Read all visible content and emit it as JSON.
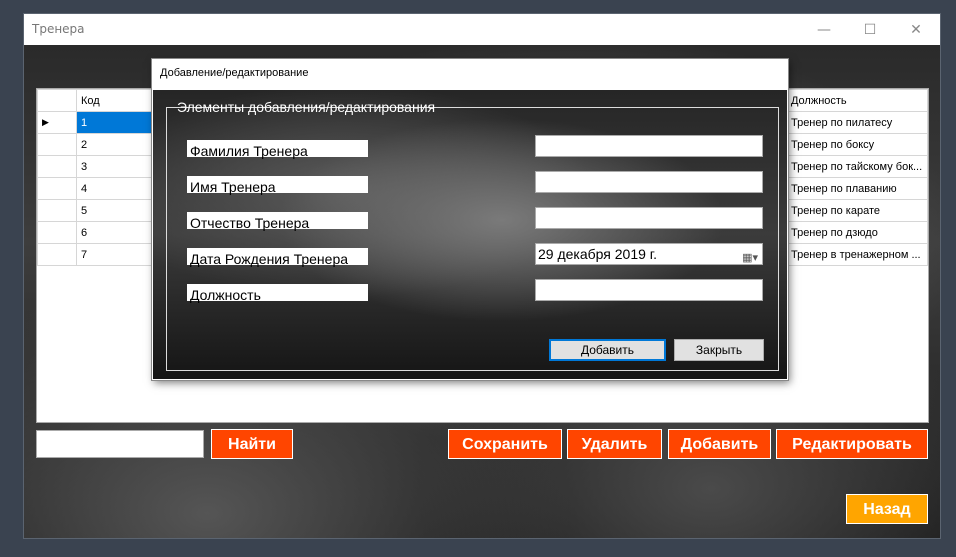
{
  "window": {
    "title": "Тренера",
    "minimize": "—",
    "maximize": "☐",
    "close": "✕"
  },
  "grid": {
    "headers": [
      "Код",
      "Должность"
    ],
    "rows": [
      {
        "code": "1",
        "position": "Тренер по пилатесу"
      },
      {
        "code": "2",
        "position": "Тренер по боксу"
      },
      {
        "code": "3",
        "position": "Тренер по тайскому бок..."
      },
      {
        "code": "4",
        "position": "Тренер по плаванию"
      },
      {
        "code": "5",
        "position": "Тренер по карате"
      },
      {
        "code": "6",
        "position": "Тренер по дзюдо"
      },
      {
        "code": "7",
        "position": "Тренер в тренажерном ..."
      }
    ]
  },
  "dialog": {
    "title": "Добавление/редактирование",
    "group_title": "Элементы добавления/редактирования",
    "labels": {
      "surname": "Фамилия Тренера",
      "name": "Имя Тренера",
      "patronymic": "Отчество Тренера",
      "birthdate": "Дата Рождения Тренера",
      "position": "Должность"
    },
    "values": {
      "surname": "",
      "name": "",
      "patronymic": "",
      "position": ""
    },
    "birthdate_value": "29  декабря  2019 г.",
    "add_button": "Добавить",
    "close_button": "Закрыть"
  },
  "toolbar": {
    "search_value": "",
    "find": "Найти",
    "save": "Сохранить",
    "delete": "Удалить",
    "add": "Добавить",
    "edit": "Редактировать",
    "back": "Назад"
  },
  "colors": {
    "action": "#ff4500",
    "back": "#ffa500",
    "selection": "#0078d7"
  }
}
